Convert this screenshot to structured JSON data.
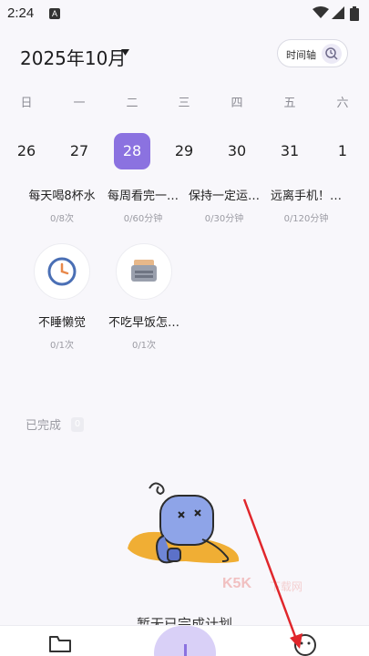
{
  "status_bar": {
    "time": "2:24",
    "badge": "A"
  },
  "header": {
    "month": "2025年10月",
    "timeline_label": "时间轴"
  },
  "weekdays": [
    "日",
    "一",
    "二",
    "三",
    "四",
    "五",
    "六"
  ],
  "dates": [
    "26",
    "27",
    "28",
    "29",
    "30",
    "31",
    "1"
  ],
  "selected_date": "28",
  "habits_row1": [
    {
      "title": "每天喝8杯水",
      "progress": "0/8次"
    },
    {
      "title": "每周看完一…",
      "progress": "0/60分钟"
    },
    {
      "title": "保持一定运…",
      "progress": "0/30分钟"
    },
    {
      "title": "远离手机！…",
      "progress": "0/120分钟"
    }
  ],
  "habits_row2": [
    {
      "title": "不睡懒觉",
      "progress": "0/1次",
      "icon": "clock-icon"
    },
    {
      "title": "不吃早饭怎…",
      "progress": "0/1次",
      "icon": "toaster-icon"
    }
  ],
  "completed": {
    "label": "已完成",
    "count": "0"
  },
  "empty_state": {
    "text": "暂无已完成计划"
  },
  "watermark": {
    "text": "K5K",
    "sub": "下载网"
  },
  "colors": {
    "accent": "#8b72e0",
    "accent_light": "#d9d0f7",
    "arrow": "#e0262b"
  }
}
